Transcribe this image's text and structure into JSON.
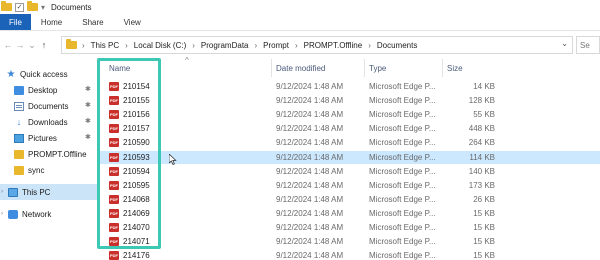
{
  "window": {
    "title": "Documents"
  },
  "quick_access": {
    "check": "✓",
    "dropdown": "▾"
  },
  "ribbon": {
    "tabs": [
      {
        "label": "File"
      },
      {
        "label": "Home"
      },
      {
        "label": "Share"
      },
      {
        "label": "View"
      }
    ]
  },
  "address": {
    "nav": {
      "back": "←",
      "forward": "→",
      "recent": "⌄",
      "up": "↑"
    },
    "root_chevron": "›",
    "breadcrumbs": [
      "This PC",
      "Local Disk (C:)",
      "ProgramData",
      "Prompt",
      "PROMPT.Offline",
      "Documents"
    ],
    "separator": "›",
    "dropdown": "⌄",
    "search_icon": "⚲",
    "search_placeholder": "Se"
  },
  "sidebar": {
    "quick_access_label": "Quick access",
    "items": [
      {
        "label": "Desktop",
        "icon": "desktop-icon",
        "pinned": true
      },
      {
        "label": "Documents",
        "icon": "documents-icon",
        "pinned": true
      },
      {
        "label": "Downloads",
        "icon": "downloads-icon",
        "pinned": true
      },
      {
        "label": "Pictures",
        "icon": "pictures-icon",
        "pinned": true
      },
      {
        "label": "PROMPT.Offline",
        "icon": "folder-icon",
        "pinned": false
      },
      {
        "label": "sync",
        "icon": "folder-icon",
        "pinned": false
      }
    ],
    "pin_glyph": "✱",
    "this_pc_label": "This PC",
    "network_label": "Network",
    "expand_glyph": "›"
  },
  "file_list": {
    "columns": {
      "name": "Name",
      "date": "Date modified",
      "type": "Type",
      "size": "Size"
    },
    "sort_glyph": "^",
    "pdf_badge": "PDF",
    "rows": [
      {
        "name": "210154",
        "date": "9/12/2024 1:48 AM",
        "type": "Microsoft Edge P...",
        "size": "14 KB",
        "selected": false
      },
      {
        "name": "210155",
        "date": "9/12/2024 1:48 AM",
        "type": "Microsoft Edge P...",
        "size": "128 KB",
        "selected": false
      },
      {
        "name": "210156",
        "date": "9/12/2024 1:48 AM",
        "type": "Microsoft Edge P...",
        "size": "55 KB",
        "selected": false
      },
      {
        "name": "210157",
        "date": "9/12/2024 1:48 AM",
        "type": "Microsoft Edge P...",
        "size": "448 KB",
        "selected": false
      },
      {
        "name": "210590",
        "date": "9/12/2024 1:48 AM",
        "type": "Microsoft Edge P...",
        "size": "264 KB",
        "selected": false
      },
      {
        "name": "210593",
        "date": "9/12/2024 1:48 AM",
        "type": "Microsoft Edge P...",
        "size": "114 KB",
        "selected": true
      },
      {
        "name": "210594",
        "date": "9/12/2024 1:48 AM",
        "type": "Microsoft Edge P...",
        "size": "140 KB",
        "selected": false
      },
      {
        "name": "210595",
        "date": "9/12/2024 1:48 AM",
        "type": "Microsoft Edge P...",
        "size": "173 KB",
        "selected": false
      },
      {
        "name": "214068",
        "date": "9/12/2024 1:48 AM",
        "type": "Microsoft Edge P...",
        "size": "26 KB",
        "selected": false
      },
      {
        "name": "214069",
        "date": "9/12/2024 1:48 AM",
        "type": "Microsoft Edge P...",
        "size": "15 KB",
        "selected": false
      },
      {
        "name": "214070",
        "date": "9/12/2024 1:48 AM",
        "type": "Microsoft Edge P...",
        "size": "15 KB",
        "selected": false
      },
      {
        "name": "214071",
        "date": "9/12/2024 1:48 AM",
        "type": "Microsoft Edge P...",
        "size": "15 KB",
        "selected": false
      },
      {
        "name": "214176",
        "date": "9/12/2024 1:48 AM",
        "type": "Microsoft Edge P...",
        "size": "15 KB",
        "selected": false
      }
    ]
  },
  "colors": {
    "file_tab": "#1a63b8",
    "selection": "#cce8ff",
    "highlight_box": "#3cc8b4",
    "pdf_icon": "#c9302c",
    "folder": "#e8b72b"
  }
}
